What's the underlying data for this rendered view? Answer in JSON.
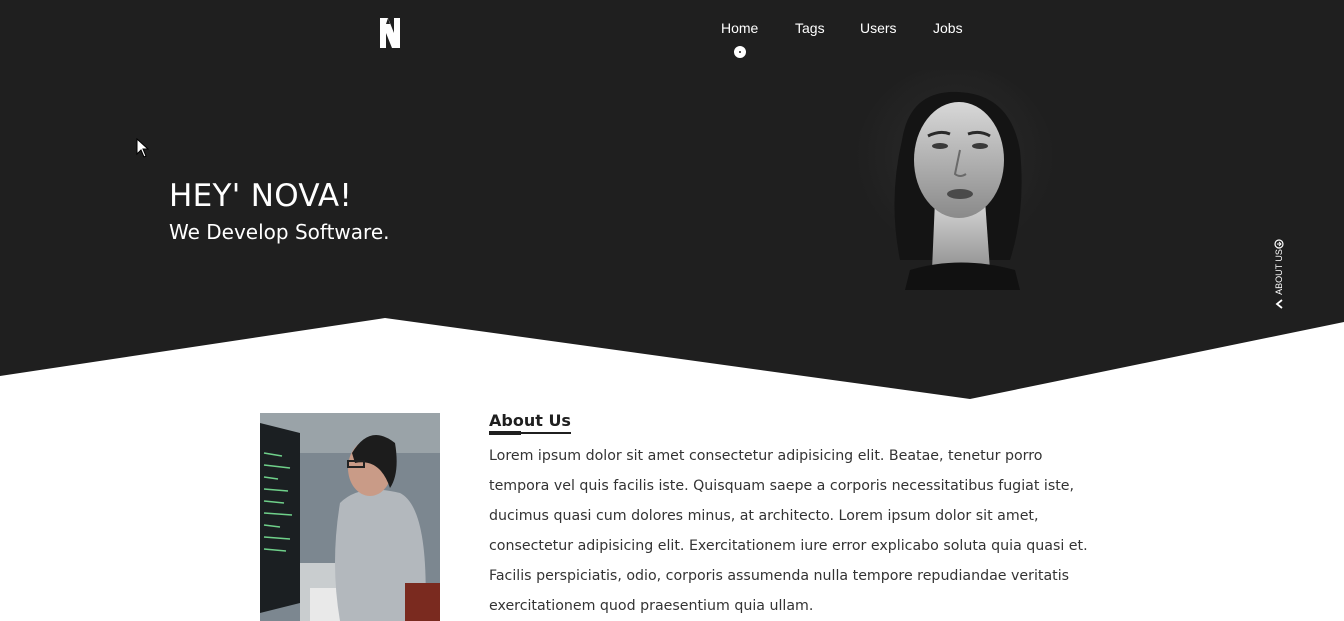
{
  "colors": {
    "hero_bg": "#1f1f1f",
    "text_light": "#ffffff",
    "text_dark": "#333333"
  },
  "nav": {
    "items": [
      {
        "label": "Home",
        "active": true
      },
      {
        "label": "Tags"
      },
      {
        "label": "Users"
      },
      {
        "label": "Jobs"
      }
    ]
  },
  "hero": {
    "title": "HEY' NOVA!",
    "subtitle": "We Develop Software."
  },
  "side_tab": {
    "label": "ABOUT US",
    "icon": "chevron-left-icon"
  },
  "about": {
    "heading": "About Us",
    "body": "Lorem ipsum dolor sit amet consectetur adipisicing elit. Beatae, tenetur porro tempora vel quis facilis iste. Quisquam saepe a corporis necessitatibus fugiat iste, ducimus quasi cum dolores minus, at architecto. Lorem ipsum dolor sit amet, consectetur adipisicing elit. Exercitationem iure error explicabo soluta quia quasi et. Facilis perspiciatis, odio, corporis assumenda nulla tempore repudiandae veritatis exercitationem quod praesentium quia ullam."
  }
}
